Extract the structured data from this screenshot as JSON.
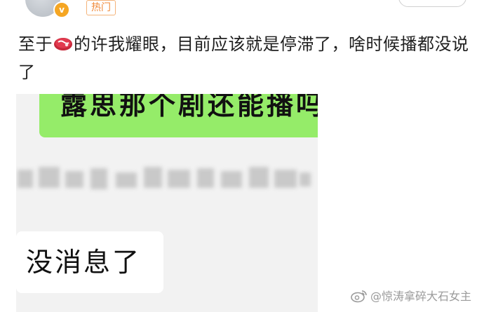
{
  "header": {
    "hot_tag": "热门",
    "verified_badge": "v"
  },
  "post": {
    "text_before_icon": "至于",
    "icon": "steak-icon",
    "text_after_icon": "的许我耀眼，目前应该就是停滞了，啥时候播都没说了"
  },
  "screenshot": {
    "green_message": "露思那个剧还能播吗",
    "white_message": "没消息了"
  },
  "watermark": {
    "icon": "weibo-icon",
    "text": "@惊涛拿碎大石女主"
  },
  "colors": {
    "green_bubble": "#95ec69",
    "hot_tag": "#f08a3a",
    "verified_badge": "#f5a623"
  }
}
